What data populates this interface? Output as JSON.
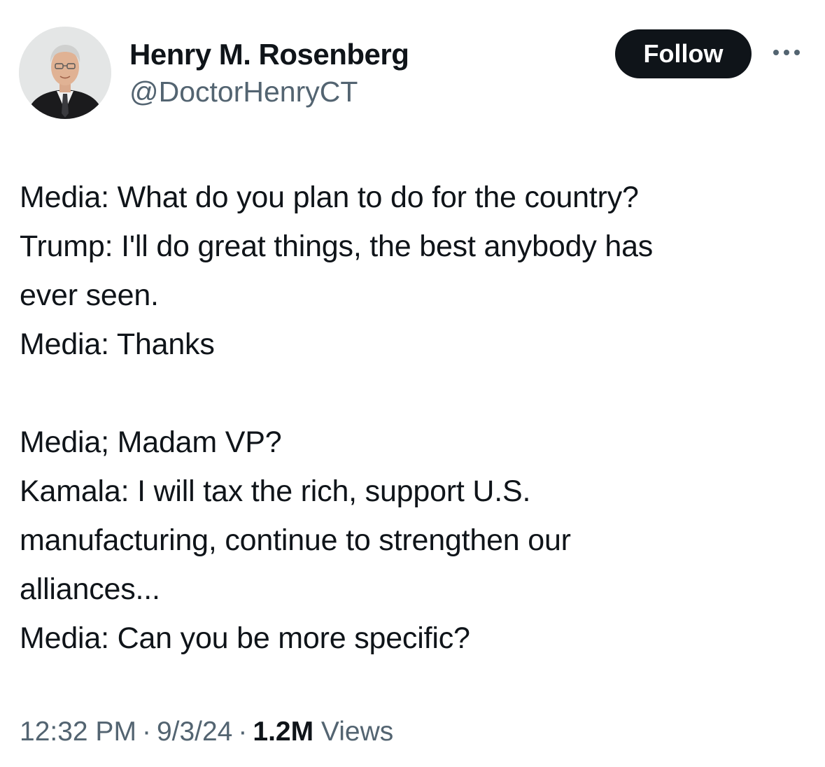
{
  "author": {
    "display_name": "Henry M. Rosenberg",
    "handle": "@DoctorHenryCT"
  },
  "actions": {
    "follow_label": "Follow",
    "more_icon": "more-horizontal-icon"
  },
  "tweet": {
    "lines": [
      "Media: What do you plan to do for the country?",
      "Trump: I'll do great things, the best anybody has",
      "ever seen.",
      "Media: Thanks",
      "",
      "Media; Madam VP?",
      "Kamala: I will tax the rich, support U.S.",
      "manufacturing, continue to strengthen our",
      "alliances...",
      "Media: Can you be more specific?"
    ]
  },
  "meta": {
    "time": "12:32 PM",
    "separator": "·",
    "date": "9/3/24",
    "views_count": "1.2M",
    "views_label": "Views"
  },
  "colors": {
    "text": "#0f1419",
    "secondary": "#536471",
    "button_bg": "#0f1419",
    "button_text": "#ffffff",
    "background": "#ffffff"
  }
}
